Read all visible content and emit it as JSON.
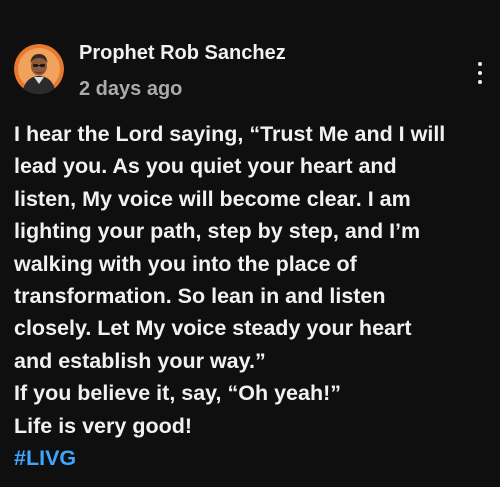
{
  "post": {
    "author": "Prophet Rob Sanchez",
    "time_ago": "2 days ago",
    "avatar_icon": "profile-avatar",
    "more_icon": "more-vertical-icon",
    "lines": [
      "I hear the Lord saying, “Trust Me and I will",
      "lead you. As you quiet your heart and",
      "listen, My voice will become clear. I am",
      "lighting your path, step by step, and I’m",
      "walking with you into the place of",
      "transformation. So lean in and listen",
      "closely. Let My voice steady your heart",
      "and establish your way.”",
      "If you believe it, say, “Oh yeah!”",
      "Life is very good!"
    ],
    "hashtag": "#LIVG"
  },
  "colors": {
    "background": "#0f0f0f",
    "text": "#f1f1f1",
    "secondary_text": "#aaaaaa",
    "hashtag": "#3ea6ff",
    "avatar_ring": "#e8792f"
  }
}
